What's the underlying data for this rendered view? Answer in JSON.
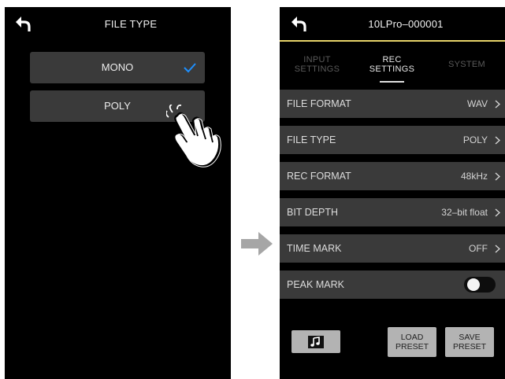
{
  "colors": {
    "accent": "#e8d46a",
    "check": "#1e90ff",
    "arrow": "#a6a6a6"
  },
  "left_screen": {
    "title": "FILE TYPE",
    "back_icon": "back-arrow-icon",
    "options": [
      {
        "label": "MONO",
        "selected": true
      },
      {
        "label": "POLY",
        "selected": false
      }
    ],
    "pointer_icon": "tapping-hand-icon"
  },
  "transition_arrow": "right-arrow-icon",
  "right_screen": {
    "title": "10LPro–000001",
    "back_icon": "back-arrow-icon",
    "tabs": [
      {
        "line1": "INPUT",
        "line2": "SETTINGS",
        "active": false
      },
      {
        "line1": "REC",
        "line2": "SETTINGS",
        "active": true
      },
      {
        "line1": "SYSTEM",
        "line2": "",
        "active": false
      }
    ],
    "rows": [
      {
        "label": "FILE FORMAT",
        "value": "WAV"
      },
      {
        "label": "FILE TYPE",
        "value": "POLY"
      },
      {
        "label": "REC FORMAT",
        "value": "48kHz"
      },
      {
        "label": "BIT DEPTH",
        "value": "32–bit float"
      },
      {
        "label": "TIME MARK",
        "value": "OFF"
      },
      {
        "label": "PEAK MARK",
        "value": "",
        "toggle": "off"
      }
    ],
    "buttons": {
      "music_icon": "music-note-icon",
      "load_line1": "LOAD",
      "load_line2": "PRESET",
      "save_line1": "SAVE",
      "save_line2": "PRESET"
    }
  }
}
